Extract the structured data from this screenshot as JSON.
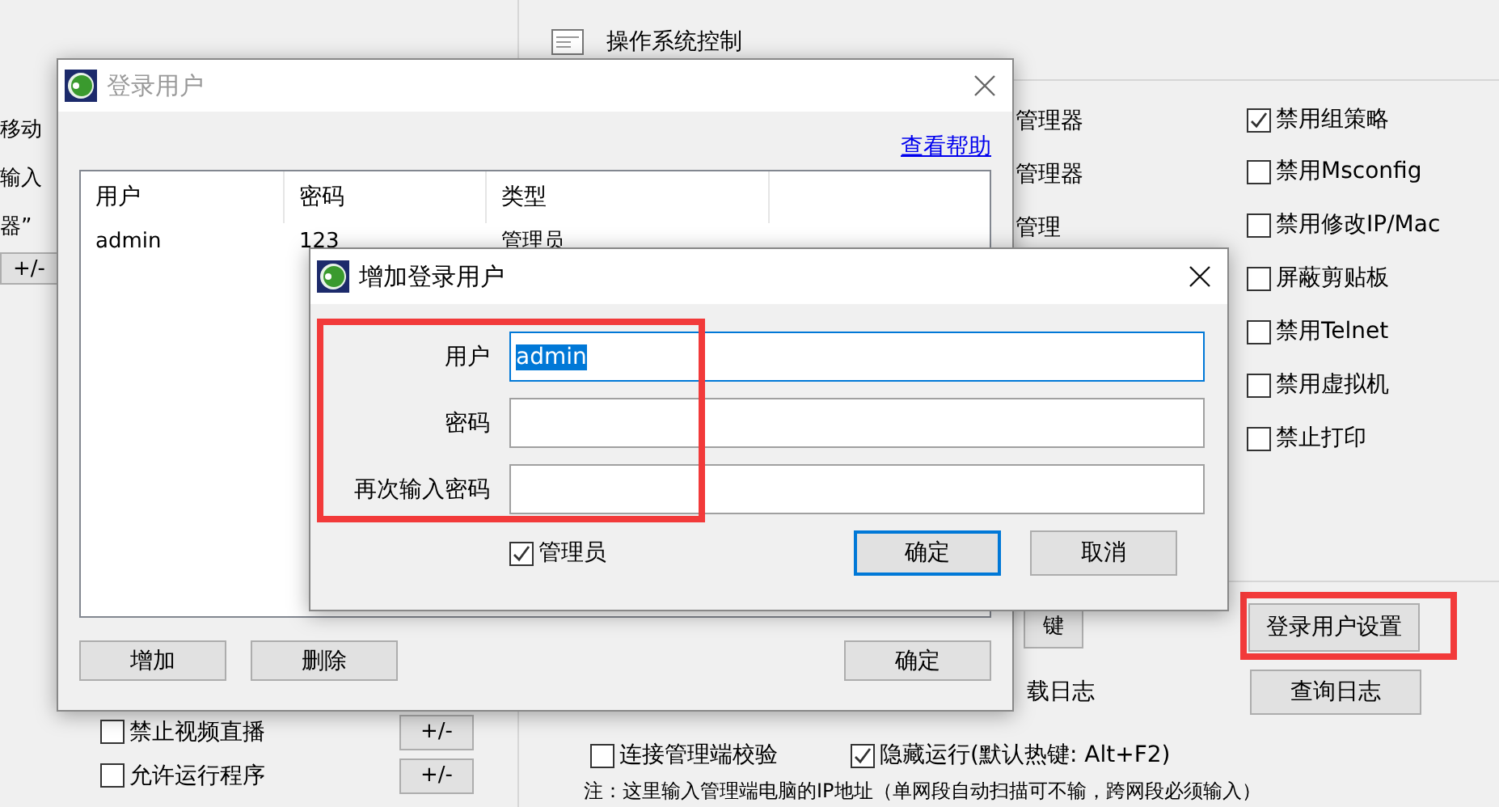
{
  "background_window": {
    "left_panel": {
      "fragments": [
        "移动",
        "输入",
        "器”"
      ],
      "fragment_button": "+/-",
      "options": [
        {
          "label": "禁止视频直播",
          "checked": false,
          "button": "+/-"
        },
        {
          "label": "允许运行程序",
          "checked": false,
          "button": "+/-"
        }
      ]
    },
    "os_control": {
      "title": "操作系统控制",
      "left_items": [
        "管理器",
        "管理器",
        "管理"
      ],
      "options": [
        {
          "label": "禁用组策略",
          "checked": true
        },
        {
          "label": "禁用Msconfig",
          "checked": false
        },
        {
          "label": "禁用修改IP/Mac",
          "checked": false
        },
        {
          "label": "屏蔽剪贴板",
          "checked": false
        },
        {
          "label": "禁用Telnet",
          "checked": false
        },
        {
          "label": "禁用虚拟机",
          "checked": false
        },
        {
          "label": "禁止打印",
          "checked": false
        }
      ]
    },
    "actions": {
      "partial_button": "键",
      "login_user_settings": "登录用户设置",
      "partial_text": "载日志",
      "query_log": "查询日志"
    },
    "toggles": [
      {
        "label": "连接管理端校验",
        "checked": false
      },
      {
        "label": "隐藏运行(默认热键: Alt+F2)",
        "checked": true
      }
    ],
    "note": "注：这里输入管理端电脑的IP地址（单网段自动扫描可不输，跨网段必须输入）"
  },
  "login_users_dialog": {
    "title": "登录用户",
    "active": false,
    "help_link": "查看帮助",
    "columns": [
      "用户",
      "密码",
      "类型"
    ],
    "rows": [
      [
        "admin",
        "123",
        "管理员"
      ]
    ],
    "buttons": [
      "增加",
      "删除",
      "确定"
    ]
  },
  "add_user_dialog": {
    "title": "增加登录用户",
    "active": true,
    "fields": [
      {
        "label": "用户",
        "value": "admin",
        "value_selected": true,
        "focused": true
      },
      {
        "label": "密码",
        "focused": false
      },
      {
        "label": "再次输入密码",
        "focused": false
      }
    ],
    "admin_checkbox": {
      "label": "管理员",
      "checked": true
    },
    "buttons": [
      {
        "label": "确定",
        "default": true
      },
      {
        "label": "取消",
        "default": false
      }
    ]
  }
}
